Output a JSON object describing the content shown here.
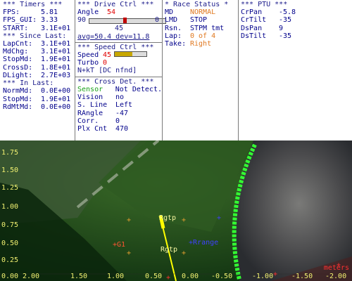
{
  "timers": {
    "header": "*** Timers ***",
    "rows": [
      {
        "label": "FPS:",
        "value": "5.81"
      },
      {
        "label": "FPS_GUI:",
        "value": "3.33"
      },
      {
        "label": "START:",
        "value": "3.1E+01"
      }
    ],
    "since_header": "*** Since Last:",
    "since_rows": [
      {
        "label": "LapCnt:",
        "value": "3.1E+01"
      },
      {
        "label": "MdChg:",
        "value": "3.1E+01"
      },
      {
        "label": "StopMd:",
        "value": "1.9E+01"
      },
      {
        "label": "CrossD:",
        "value": "1.8E+01"
      },
      {
        "label": "DLight:",
        "value": "2.7E+03"
      }
    ],
    "in_header": "*** In Last:",
    "in_rows": [
      {
        "label": "NormMd:",
        "value": "0.0E+00"
      },
      {
        "label": "StopMd:",
        "value": "1.9E+01"
      },
      {
        "label": "RdMtMd:",
        "value": "0.0E+00"
      }
    ]
  },
  "drive": {
    "header": "*** Drive Ctrl ***",
    "angle_label": "Angle",
    "angle_value": "54",
    "bar_left": "90",
    "bar_right": "0",
    "angle_readout": "45",
    "avg_text": "avg=50.4 dev=11.8",
    "speed_header": "*** Speed Ctrl ***",
    "speed_label": "Speed",
    "speed_value": "45",
    "speed_fill": 0.55,
    "turbo_label": "Turbo",
    "turbo_value": "0",
    "nkt": "N+kT [DC nfnd]",
    "cross_header": "*** Cross Det. ***",
    "cross_rows": [
      {
        "label": "Sensor",
        "value": "Not Detect."
      },
      {
        "label": "Vision",
        "value": "no"
      },
      {
        "label": "S. Line",
        "value": "Left"
      },
      {
        "label": "RAngle",
        "value": "-47"
      },
      {
        "label": "Corr.",
        "value": "0"
      },
      {
        "label": "Plx Cnt",
        "value": "470"
      }
    ]
  },
  "race": {
    "header": "* Race Status *",
    "rows": [
      {
        "label": "MD",
        "value": "NORMAL"
      },
      {
        "label": "LMD",
        "value": "STOP"
      },
      {
        "label": "Rsn.",
        "value": "STPM tmt"
      },
      {
        "label": "Lap:",
        "value": "0 of 4"
      },
      {
        "label": "Take:",
        "value": "Right"
      }
    ]
  },
  "ptu": {
    "header": "*** PTU ***",
    "rows": [
      {
        "label": "CrPan",
        "value": "-5.8"
      },
      {
        "label": "CrTilt",
        "value": "-35"
      },
      {
        "label": "DsPan",
        "value": "9"
      },
      {
        "label": "DsTilt",
        "value": "-35"
      }
    ]
  },
  "camera": {
    "y_ticks": [
      "1.75",
      "1.50",
      "1.25",
      "1.00",
      "0.75",
      "0.50",
      "0.25",
      "0.00"
    ],
    "x_ticks": [
      "2.00",
      "1.50",
      "1.00",
      "0.50",
      "0.00",
      "-0.50",
      "-1.00",
      "-1.50",
      "-2.00"
    ],
    "units": "meters",
    "markers": {
      "g1": "G1",
      "rgtp_top": "Rgtp",
      "rgtp_bottom": "Rgtp",
      "range": "Rrange"
    }
  }
}
